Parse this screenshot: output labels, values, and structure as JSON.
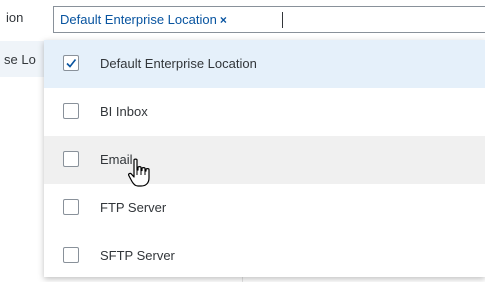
{
  "background": {
    "top_label": "ion",
    "row_label": "se Lo"
  },
  "token_input": {
    "token_text": "Default Enterprise Location",
    "token_remove": "×"
  },
  "dropdown": {
    "items": [
      {
        "label": "Default Enterprise Location",
        "checked": true
      },
      {
        "label": "BI Inbox",
        "checked": false
      },
      {
        "label": "Email",
        "checked": false
      },
      {
        "label": "FTP Server",
        "checked": false
      },
      {
        "label": "SFTP Server",
        "checked": false
      }
    ]
  },
  "colors": {
    "accent": "#0854a0",
    "selected_bg": "#e5f0fa",
    "hover_bg": "#f0f0f0",
    "checkbox_border": "#89919a"
  },
  "icons": {
    "check": "check-icon",
    "cursor": "hand-pointer-icon"
  }
}
